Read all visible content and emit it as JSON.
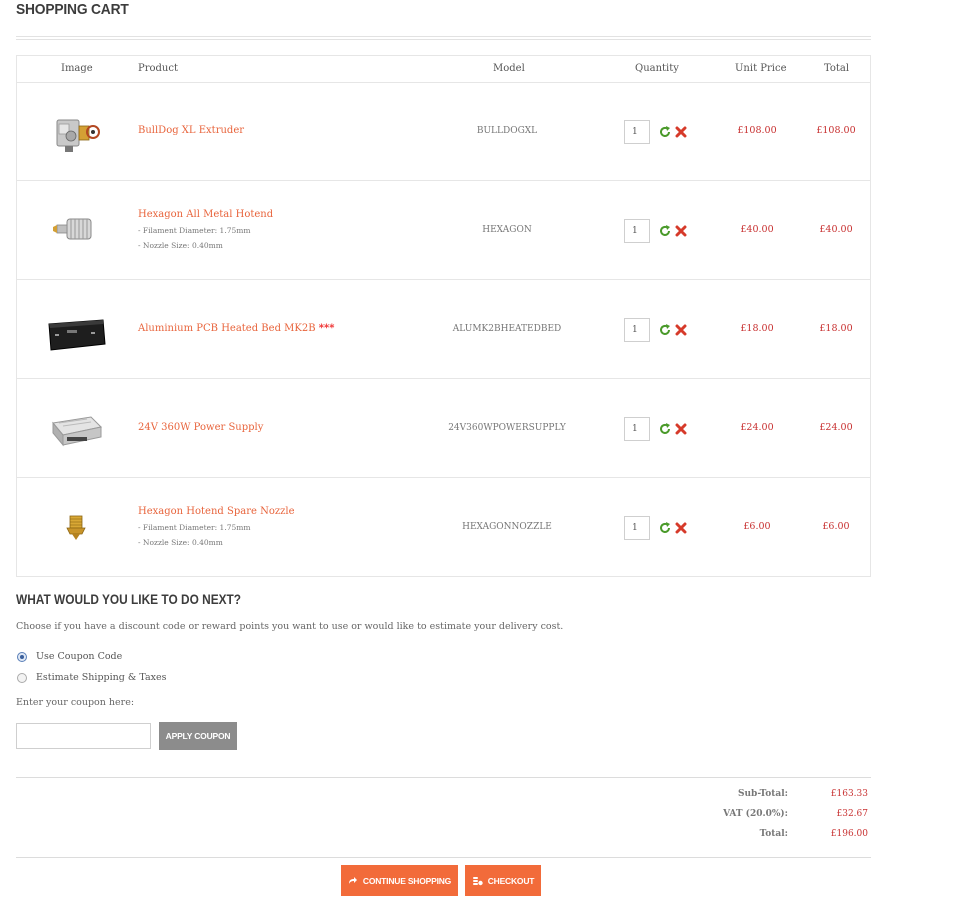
{
  "page": {
    "title": "SHOPPING CART"
  },
  "table": {
    "headers": {
      "image": "Image",
      "product": "Product",
      "model": "Model",
      "quantity": "Quantity",
      "unit_price": "Unit Price",
      "total": "Total"
    },
    "rows": [
      {
        "name": "BullDog XL Extruder",
        "options": [],
        "required_mark": "",
        "model": "BULLDOGXL",
        "quantity": "1",
        "unit_price": "£108.00",
        "total": "£108.00",
        "thumb_icon": "extruder-icon"
      },
      {
        "name": "Hexagon All Metal Hotend",
        "options": [
          "- Filament Diameter: 1.75mm",
          "- Nozzle Size: 0.40mm"
        ],
        "required_mark": "",
        "model": "HEXAGON",
        "quantity": "1",
        "unit_price": "£40.00",
        "total": "£40.00",
        "thumb_icon": "hotend-icon"
      },
      {
        "name": "Aluminium PCB Heated Bed MK2B",
        "options": [],
        "required_mark": "***",
        "model": "ALUMK2BHEATEDBED",
        "quantity": "1",
        "unit_price": "£18.00",
        "total": "£18.00",
        "thumb_icon": "heated-bed-icon"
      },
      {
        "name": "24V 360W Power Supply",
        "options": [],
        "required_mark": "",
        "model": "24V360WPOWERSUPPLY",
        "quantity": "1",
        "unit_price": "£24.00",
        "total": "£24.00",
        "thumb_icon": "power-supply-icon"
      },
      {
        "name": "Hexagon Hotend Spare Nozzle",
        "options": [
          "- Filament Diameter: 1.75mm",
          "- Nozzle Size: 0.40mm"
        ],
        "required_mark": "",
        "model": "HEXAGONNOZZLE",
        "quantity": "1",
        "unit_price": "£6.00",
        "total": "£6.00",
        "thumb_icon": "nozzle-icon"
      }
    ]
  },
  "next": {
    "title": "WHAT WOULD YOU LIKE TO DO NEXT?",
    "description": "Choose if you have a discount code or reward points you want to use or would like to estimate your delivery cost.",
    "options": [
      {
        "label": "Use Coupon Code",
        "selected": true
      },
      {
        "label": "Estimate Shipping & Taxes",
        "selected": false
      }
    ],
    "coupon_label": "Enter your coupon here:",
    "coupon_value": "",
    "apply_label": "APPLY COUPON"
  },
  "totals": [
    {
      "label": "Sub-Total:",
      "value": "£163.33"
    },
    {
      "label": "VAT (20.0%):",
      "value": "£32.67"
    },
    {
      "label": "Total:",
      "value": "£196.00"
    }
  ],
  "actions": {
    "continue_label": "CONTINUE SHOPPING",
    "checkout_label": "CHECKOUT"
  },
  "colors": {
    "accent": "#f26b3a",
    "price": "#c83232",
    "link": "#e8643c",
    "refresh": "#4a9a2a",
    "remove": "#d63a2a",
    "button_grey": "#8c8c8c"
  }
}
